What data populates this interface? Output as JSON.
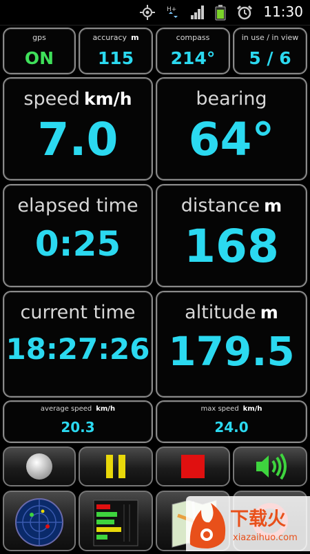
{
  "status_bar": {
    "time": "11:30",
    "icons": [
      "gps-icon",
      "data-activity-icon",
      "signal-icon",
      "battery-icon",
      "alarm-icon"
    ]
  },
  "top_row": {
    "gps": {
      "label": "gps",
      "value": "ON"
    },
    "accuracy": {
      "label": "accuracy",
      "unit": "m",
      "value": "115"
    },
    "compass": {
      "label": "compass",
      "value": "214°"
    },
    "satellites": {
      "label": "in use / in view",
      "value": "5 / 6"
    }
  },
  "tiles": {
    "speed": {
      "label": "speed",
      "unit": "km/h",
      "value": "7.0"
    },
    "bearing": {
      "label": "bearing",
      "value": "64°"
    },
    "elapsed_time": {
      "label": "elapsed time",
      "value": "0:25"
    },
    "distance": {
      "label": "distance",
      "unit": "m",
      "value": "168"
    },
    "current_time": {
      "label": "current time",
      "value": "18:27:26"
    },
    "altitude": {
      "label": "altitude",
      "unit": "m",
      "value": "179.5"
    }
  },
  "summary": {
    "average_speed": {
      "label": "average speed",
      "unit": "km/h",
      "value": "20.3"
    },
    "max_speed": {
      "label": "max speed",
      "unit": "km/h",
      "value": "24.0"
    }
  },
  "controls": [
    "record-icon",
    "pause-icon",
    "stop-icon",
    "sound-icon"
  ],
  "tools": [
    "radar-icon",
    "satellite-bars-icon",
    "map-icon",
    "exit-icon"
  ],
  "watermark": {
    "brand": "下载火",
    "domain": "xiazaihuo.com"
  },
  "colors": {
    "accent": "#2bd9f0",
    "on": "#3fe05a",
    "stop": "#e01010",
    "pause": "#e8d80a",
    "sound": "#3ed43e"
  }
}
